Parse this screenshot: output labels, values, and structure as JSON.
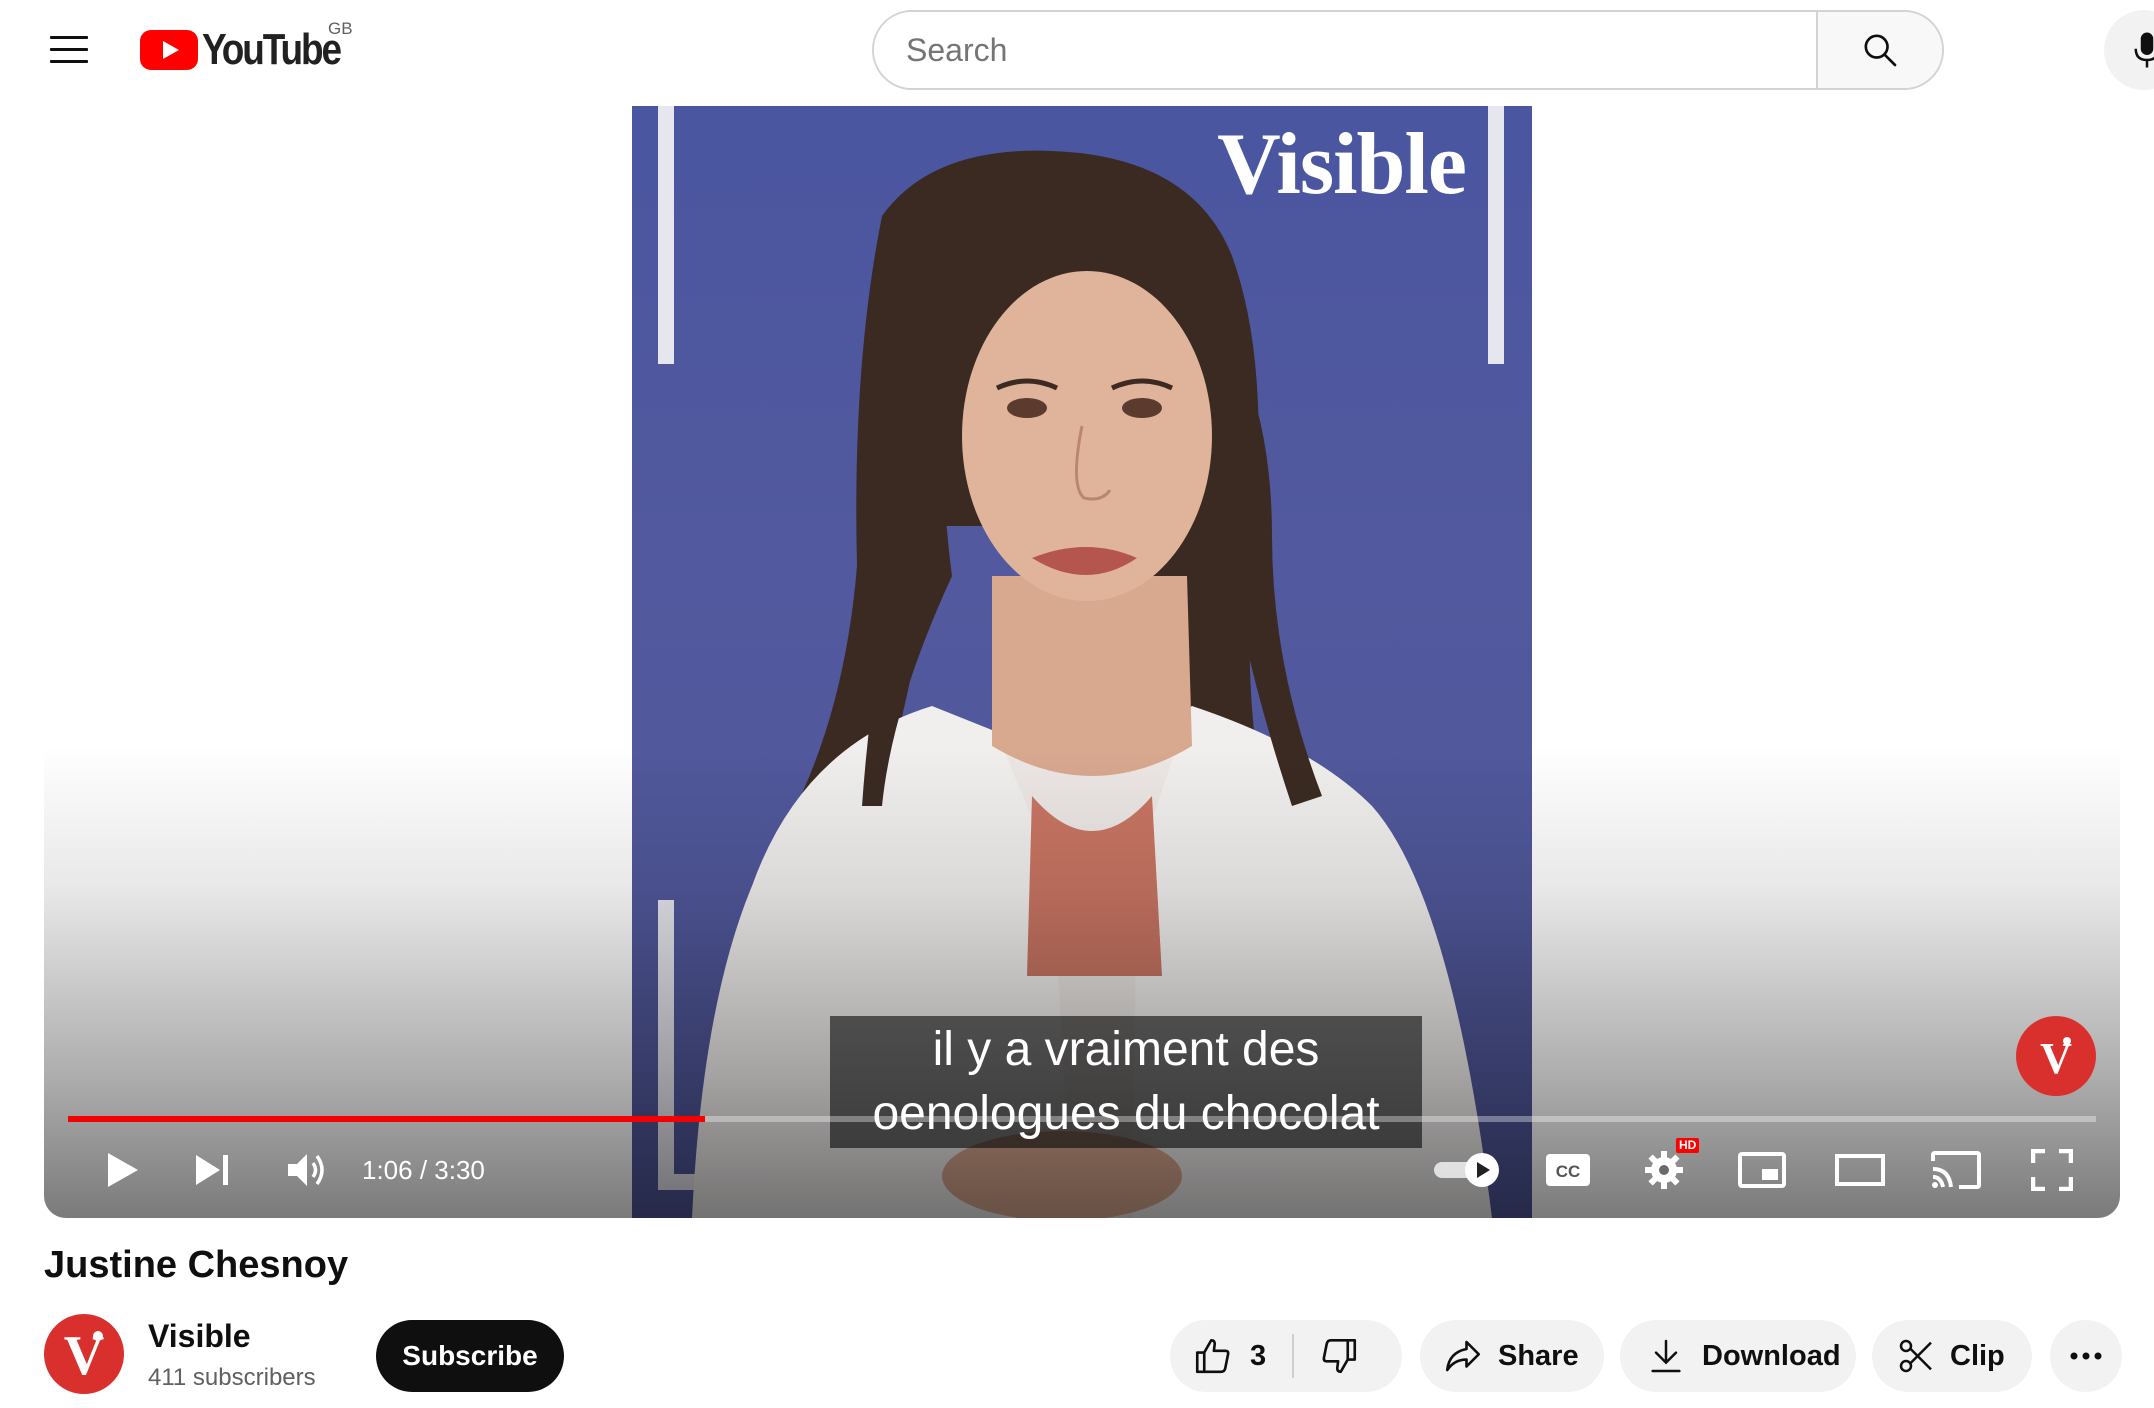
{
  "header": {
    "logo_text": "YouTube",
    "country_code": "GB",
    "search_placeholder": "Search"
  },
  "player": {
    "watermark_text": "Visible",
    "caption_line1": "il y a vraiment des",
    "caption_line2": "oenologues du chocolat",
    "current_time": "1:06",
    "duration": "3:30",
    "time_display": "1:06 / 3:30",
    "progress_fraction": 0.314,
    "autoplay": "on",
    "quality_badge": "HD",
    "channel_watermark_letter": "V",
    "colors": {
      "progress": "#f40000",
      "brand_red": "#d9302e",
      "video_bg": "#4f5697"
    }
  },
  "video": {
    "title": "Justine Chesnoy"
  },
  "channel": {
    "avatar_letter": "V",
    "name": "Visible",
    "subscribers": "411 subscribers",
    "subscribe_label": "Subscribe"
  },
  "actions": {
    "like_count": "3",
    "share_label": "Share",
    "download_label": "Download",
    "clip_label": "Clip"
  },
  "icons": [
    "menu-icon",
    "youtube-logo-icon",
    "search-icon",
    "mic-icon",
    "play-icon",
    "next-icon",
    "volume-icon",
    "autoplay-toggle",
    "captions-icon",
    "settings-icon",
    "miniplayer-icon",
    "theater-icon",
    "cast-icon",
    "fullscreen-icon",
    "like-icon",
    "dislike-icon",
    "share-icon",
    "download-icon",
    "clip-icon",
    "more-icon"
  ]
}
